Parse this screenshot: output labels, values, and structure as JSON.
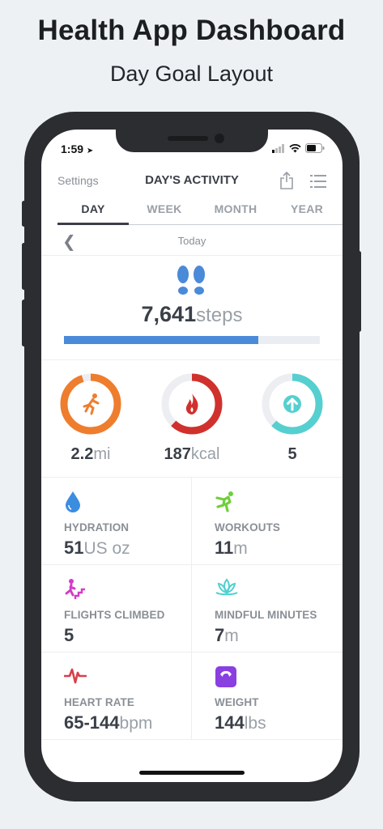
{
  "promo": {
    "headline": "Health App Dashboard",
    "subhead": "Day Goal Layout"
  },
  "status_bar": {
    "time": "1:59"
  },
  "nav": {
    "settings_label": "Settings",
    "title": "DAY'S ACTIVITY"
  },
  "tabs": [
    {
      "label": "DAY",
      "active": true
    },
    {
      "label": "WEEK",
      "active": false
    },
    {
      "label": "MONTH",
      "active": false
    },
    {
      "label": "YEAR",
      "active": false
    }
  ],
  "date": {
    "label": "Today"
  },
  "steps": {
    "value": "7,641",
    "unit": "steps",
    "progress": 0.76,
    "color": "#4a8ad8"
  },
  "rings": [
    {
      "icon": "running-icon",
      "value": "2.2",
      "unit": "mi",
      "progress": 0.95,
      "color": "#ee7d2e"
    },
    {
      "icon": "flame-icon",
      "value": "187",
      "unit": "kcal",
      "progress": 0.62,
      "color": "#d0312d"
    },
    {
      "icon": "arrow-up-icon",
      "value": "5",
      "unit": "",
      "progress": 0.62,
      "color": "#56cfd0"
    }
  ],
  "metrics": [
    {
      "icon": "water-drop-icon",
      "label": "HYDRATION",
      "value": "51",
      "unit": "US oz",
      "color": "#3b8de0"
    },
    {
      "icon": "workout-figure-icon",
      "label": "WORKOUTS",
      "value": "11",
      "unit": "m",
      "color": "#6fcf3a"
    },
    {
      "icon": "stairs-climber-icon",
      "label": "FLIGHTS CLIMBED",
      "value": "5",
      "unit": "",
      "color": "#d23cc8"
    },
    {
      "icon": "lotus-icon",
      "label": "MINDFUL MINUTES",
      "value": "7",
      "unit": "m",
      "color": "#4fd1d0"
    },
    {
      "icon": "heartbeat-icon",
      "label": "HEART RATE",
      "value": "65-144",
      "unit": "bpm",
      "color": "#d8404a"
    },
    {
      "icon": "scale-icon",
      "label": "WEIGHT",
      "value": "144",
      "unit": "lbs",
      "color": "#8a3fe0"
    }
  ]
}
